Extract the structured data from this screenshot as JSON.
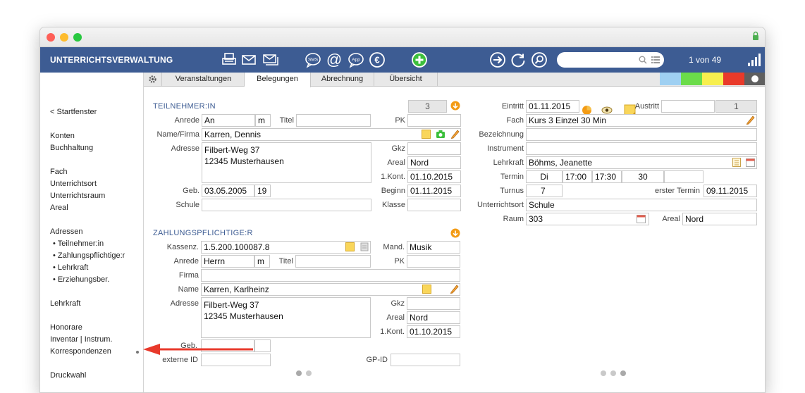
{
  "toolbar": {
    "app_title": "UNTERRICHTSVERWALTUNG",
    "record_count": "1 von 49",
    "search_placeholder": "",
    "icons": [
      "print-icon",
      "mail-icon",
      "mail-batch-icon",
      "sms-icon",
      "at-icon",
      "app-icon",
      "euro-icon",
      "add-icon",
      "forward-icon",
      "refresh-icon",
      "search-icon",
      "list-icon",
      "signal-icon"
    ]
  },
  "sidebar": {
    "back": "< Startfenster",
    "items": [
      "Konten",
      "Buchhaltung",
      "Fach",
      "Unterrichtsort",
      "Unterrichtsraum",
      "Areal",
      "Adressen",
      "• Teilnehmer:in",
      "• Zahlungspflichtige:r",
      "• Lehrkraft",
      "• Erziehungsber.",
      "Lehrkraft",
      "Honorare",
      "Inventar | Instrum.",
      "Korrespondenzen",
      "Druckwahl"
    ]
  },
  "tabs": [
    "Veranstaltungen",
    "Belegungen",
    "Abrechnung",
    "Übersicht"
  ],
  "active_tab": "Belegungen",
  "color_swatches": [
    "#9fd0f2",
    "#6bdc4a",
    "#f7ef4e",
    "#e93a2a",
    "#5f5f5f"
  ],
  "participant": {
    "section_title": "TEILNEHMER:IN",
    "count": "3",
    "anrede_label": "Anrede",
    "anrede": "An",
    "gender": "m",
    "titel_label": "Titel",
    "titel": "",
    "pk_label": "PK",
    "pk": "",
    "name_label": "Name/Firma",
    "name": "Karren, Dennis",
    "adresse_label": "Adresse",
    "adresse": "Filbert-Weg 37\n12345 Musterhausen",
    "gkz_label": "Gkz",
    "gkz": "",
    "areal_label": "Areal",
    "areal": "Nord",
    "kont_label": "1.Kont.",
    "kont": "01.10.2015",
    "geb_label": "Geb.",
    "geb": "03.05.2005",
    "age": "19",
    "beginn_label": "Beginn",
    "beginn": "01.11.2015",
    "schule_label": "Schule",
    "schule": "",
    "klasse_label": "Klasse",
    "klasse": ""
  },
  "payer": {
    "section_title": "ZAHLUNGSPFLICHTIGE:R",
    "kassenz_label": "Kassenz.",
    "kassenz": "1.5.200.100087.8",
    "mand_label": "Mand.",
    "mand": "Musik",
    "anrede_label": "Anrede",
    "anrede": "Herrn",
    "gender": "m",
    "titel_label": "Titel",
    "titel": "",
    "pk_label": "PK",
    "pk": "",
    "firma_label": "Firma",
    "firma": "",
    "name_label": "Name",
    "name": "Karren, Karlheinz",
    "adresse_label": "Adresse",
    "adresse": "Filbert-Weg 37\n12345 Musterhausen",
    "gkz_label": "Gkz",
    "gkz": "",
    "areal_label": "Areal",
    "areal": "Nord",
    "kont_label": "1.Kont.",
    "kont": "01.10.2015",
    "geb_label": "Geb.",
    "geb": "",
    "externe_id_label": "externe ID",
    "externe_id": "",
    "gp_id_label": "GP-ID",
    "gp_id": ""
  },
  "booking": {
    "eintritt_label": "Eintritt",
    "eintritt": "01.11.2015",
    "austritt_label": "Austritt",
    "austritt": "",
    "count": "1",
    "fach_label": "Fach",
    "fach": "Kurs 3 Einzel 30 Min",
    "bezeichnung_label": "Bezeichnung",
    "bezeichnung": "",
    "instrument_label": "Instrument",
    "instrument": "",
    "lehrkraft_label": "Lehrkraft",
    "lehrkraft": "Böhms, Jeanette",
    "termin_label": "Termin",
    "termin_day": "Di",
    "termin_start": "17:00",
    "termin_end": "17:30",
    "termin_minutes": "30",
    "termin_extra": "",
    "turnus_label": "Turnus",
    "turnus": "7",
    "erster_termin_label": "erster Termin",
    "erster_termin": "09.11.2015",
    "unterrichtsort_label": "Unterrichtsort",
    "unterrichtsort": "Schule",
    "raum_label": "Raum",
    "raum": "303",
    "areal_label": "Areal",
    "areal": "Nord"
  }
}
